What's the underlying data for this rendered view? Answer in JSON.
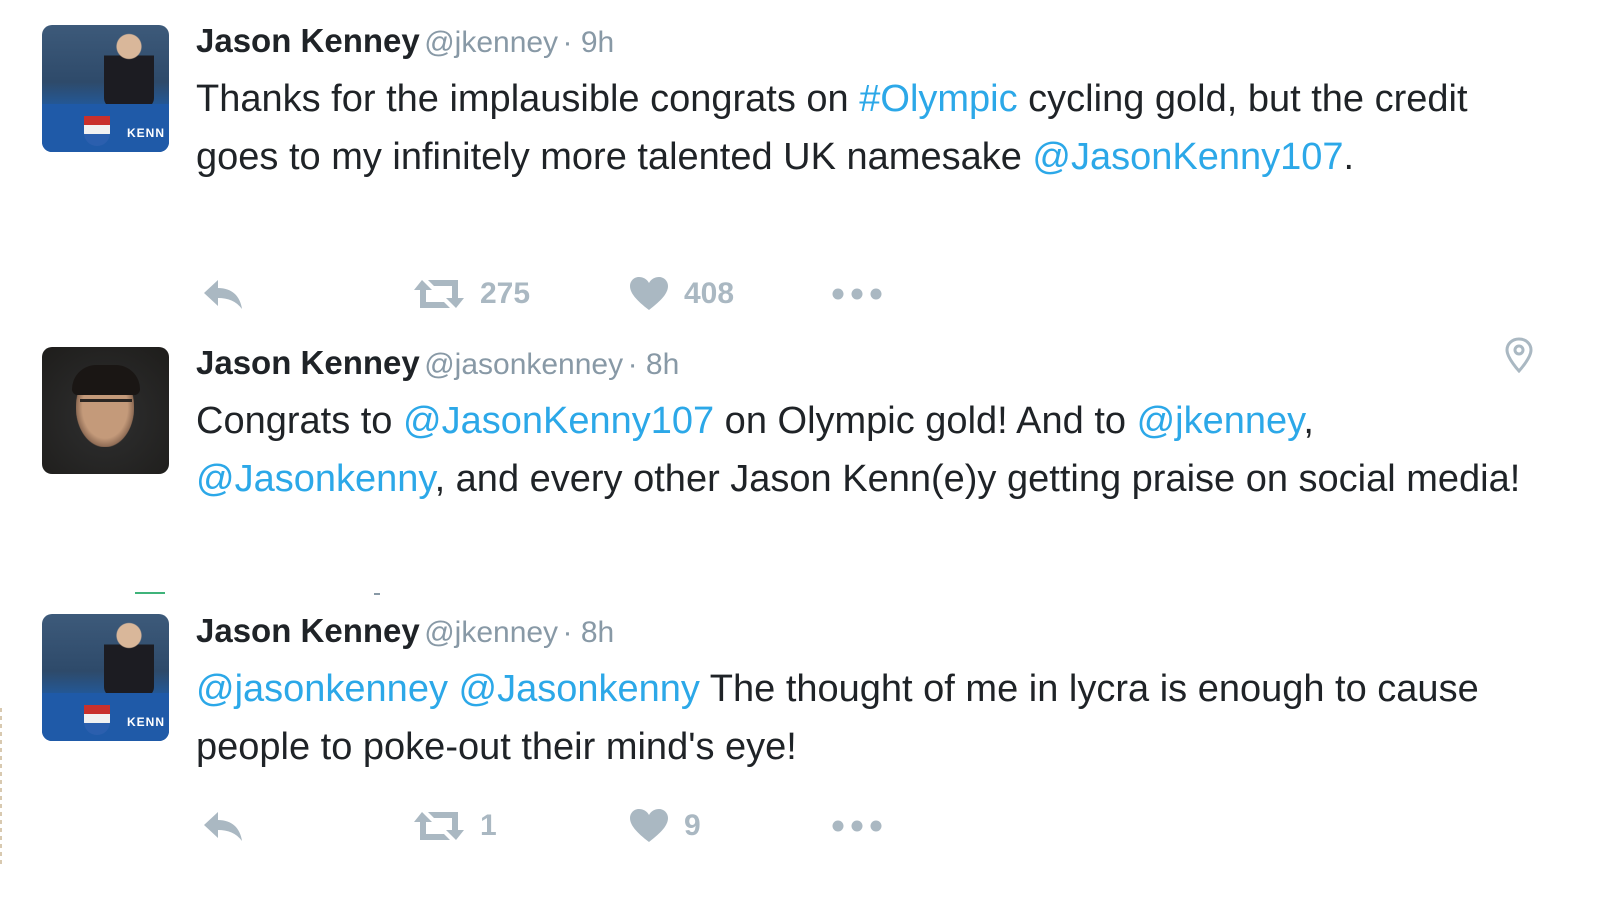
{
  "tweets": [
    {
      "name": "Jason Kenney",
      "handle": "@jkenney",
      "time": "· 9h",
      "segments": [
        {
          "text": "Thanks for the implausible congrats on ",
          "link": false
        },
        {
          "text": "#Olympic",
          "link": true
        },
        {
          "text": " cycling gold, but the credit goes to my infinitely more talented UK namesake ",
          "link": false
        },
        {
          "text": "@JasonKenny107",
          "link": true
        },
        {
          "text": ".",
          "link": false
        }
      ],
      "avatar_text": "KENN",
      "retweets": "275",
      "likes": "408"
    },
    {
      "name": "Jason Kenney",
      "handle": "@jasonkenney",
      "time": "· 8h",
      "segments": [
        {
          "text": "Congrats to ",
          "link": false
        },
        {
          "text": "@JasonKenny107",
          "link": true
        },
        {
          "text": " on Olympic gold! And to ",
          "link": false
        },
        {
          "text": "@jkenney",
          "link": true
        },
        {
          "text": ", ",
          "link": false
        },
        {
          "text": "@Jasonkenny",
          "link": true
        },
        {
          "text": ", and every other Jason Kenn(e)y getting praise on social media!",
          "link": false
        }
      ]
    },
    {
      "name": "Jason Kenney",
      "handle": "@jkenney",
      "time": "· 8h",
      "segments": [
        {
          "text": "@jasonkenney",
          "link": true
        },
        {
          "text": " ",
          "link": false
        },
        {
          "text": "@Jasonkenny",
          "link": true
        },
        {
          "text": " The thought of me in lycra is enough to cause people to poke-out their mind's eye!",
          "link": false
        }
      ],
      "avatar_text": "KENN",
      "retweets": "1",
      "likes": "9"
    }
  ],
  "icons": {
    "reply": "reply-icon",
    "retweet": "retweet-icon",
    "like": "heart-icon",
    "more": "more-icon",
    "location": "location-pin-icon"
  },
  "colors": {
    "link": "#2ca8e8",
    "muted": "#8899a6",
    "action": "#aab8c2",
    "text": "#1f2327"
  }
}
